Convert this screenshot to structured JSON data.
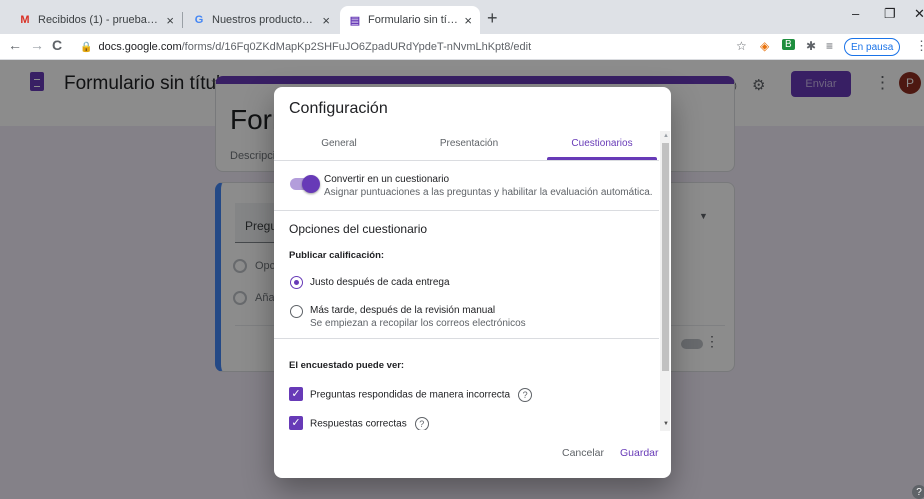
{
  "browser": {
    "tabs": [
      {
        "favicon": "gmail-icon",
        "favicon_glyph": "M",
        "favicon_color": "#d93025",
        "label": "Recibidos (1) - prueba100820@g",
        "close": "×"
      },
      {
        "favicon": "google-icon",
        "favicon_glyph": "G",
        "favicon_color": "#4285f4",
        "label": "Nuestros productos - Google",
        "close": "×"
      },
      {
        "favicon": "forms-icon",
        "favicon_glyph": "▤",
        "favicon_color": "#673ab7",
        "label": "Formulario sin título - Formularic",
        "close": "×"
      }
    ],
    "new_tab": "+",
    "window_buttons": {
      "minimize": "–",
      "maximize": "❐",
      "close": "✕"
    },
    "nav": {
      "back": "←",
      "forward": "→",
      "reload": "C"
    },
    "url_host": "docs.google.com",
    "url_path": "/forms/d/16Fq0ZKdMapKp2SHFuJO6ZpadURdYpdeT-nNvmLhKpt8/edit",
    "lock": "🔒",
    "extensions": {
      "star": "☆",
      "ext1": "◈",
      "ext2": "B",
      "puzzle": "✱",
      "reading": "≡"
    },
    "pause_label": "En pausa",
    "menu": "⋮"
  },
  "forms": {
    "title": "Formulario sin título",
    "star": "☆",
    "icons": {
      "palette": "◕",
      "preview": "◉",
      "settings": "⚙"
    },
    "send_label": "Enviar",
    "menu": "⋮",
    "avatar_letter": "P",
    "title_card": {
      "heading": "Form",
      "description": "Descripció"
    },
    "question_card": {
      "question": "Pregur",
      "options": [
        "Opció",
        "Añad"
      ],
      "type_arrow": "▼",
      "menu": "⋮"
    },
    "help": "?"
  },
  "dialog": {
    "title": "Configuración",
    "tabs": [
      {
        "label": "General",
        "active": false
      },
      {
        "label": "Presentación",
        "active": false
      },
      {
        "label": "Cuestionarios",
        "active": true
      }
    ],
    "quiz_toggle": {
      "on": true,
      "label": "Convertir en un cuestionario",
      "sub": "Asignar puntuaciones a las preguntas y habilitar la evaluación automática."
    },
    "options_title": "Opciones del cuestionario",
    "publish_heading": "Publicar calificación:",
    "publish_options": [
      {
        "label": "Justo después de cada entrega",
        "sub": "",
        "selected": true
      },
      {
        "label": "Más tarde, después de la revisión manual",
        "sub": "Se empiezan a recopilar los correos electrónicos",
        "selected": false
      }
    ],
    "respondent_heading": "El encuestado puede ver:",
    "respondent_options": [
      {
        "label": "Preguntas respondidas de manera incorrecta",
        "checked": true,
        "help": "?"
      },
      {
        "label": "Respuestas correctas",
        "checked": true,
        "help": "?"
      }
    ],
    "check_glyph": "✓",
    "cancel_label": "Cancelar",
    "save_label": "Guardar",
    "scroll_up": "▲",
    "scroll_down": "▼"
  },
  "colors": {
    "accent": "#673ab7",
    "question_accent": "#4285f4",
    "page_bg": "#f0ebf8"
  }
}
